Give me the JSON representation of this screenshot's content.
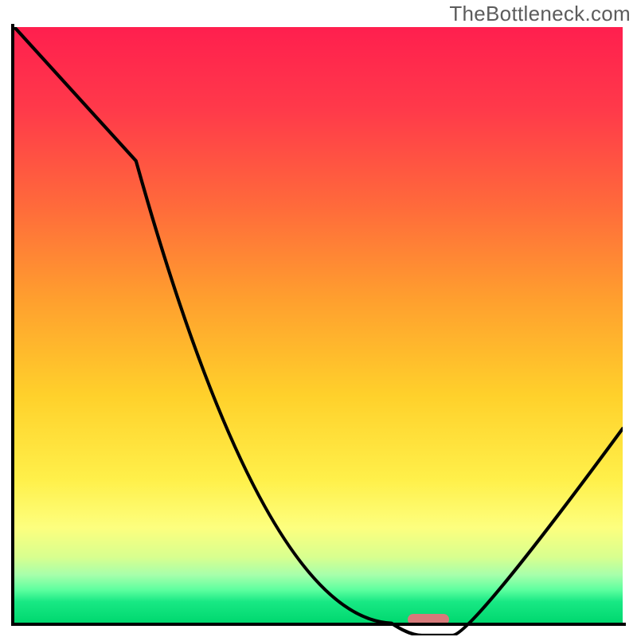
{
  "watermark": "TheBottleneck.com",
  "chart_data": {
    "type": "line",
    "title": "",
    "xlabel": "",
    "ylabel": "",
    "xlim": [
      0,
      100
    ],
    "ylim": [
      0,
      100
    ],
    "series": [
      {
        "name": "bottleneck-curve",
        "x": [
          0,
          20,
          62,
          67,
          72,
          100
        ],
        "y": [
          100,
          78,
          2,
          0,
          0,
          34
        ]
      }
    ],
    "annotations": [
      {
        "name": "optimal-marker",
        "x": 68,
        "y": 0,
        "color": "#d77a7a"
      }
    ],
    "background_gradient_stops": [
      {
        "pos": 0.0,
        "color": "#ff1f4e"
      },
      {
        "pos": 0.3,
        "color": "#ff6a3b"
      },
      {
        "pos": 0.62,
        "color": "#ffd12b"
      },
      {
        "pos": 0.84,
        "color": "#fdff7e"
      },
      {
        "pos": 0.95,
        "color": "#5dff9f"
      },
      {
        "pos": 1.0,
        "color": "#00d86f"
      }
    ]
  }
}
